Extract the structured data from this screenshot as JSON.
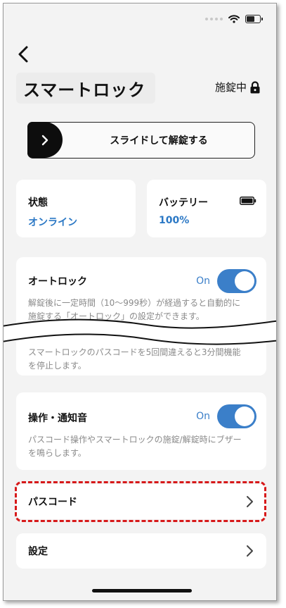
{
  "status_bar": {
    "wifi_icon": "wifi-icon",
    "battery_icon": "battery-icon"
  },
  "header": {
    "back_icon": "chevron-left-icon",
    "title": "スマートロック",
    "lock_status": "施錠中",
    "lock_icon": "lock-icon"
  },
  "slider": {
    "label": "スライドして解錠する",
    "knob_icon": "chevron-right-icon"
  },
  "status_card": {
    "title": "状態",
    "value": "オンライン"
  },
  "battery_card": {
    "title": "バッテリー",
    "value": "100%",
    "icon": "battery-icon"
  },
  "auto_lock": {
    "title": "オートロック",
    "toggle_label": "On",
    "enabled": true,
    "desc_line1": "解錠後に一定時間（10〜999秒）が経過すると自動的に",
    "desc_line2": "施錠する「オートロック」の設定ができます。",
    "desc_line3": "スマートロックのパスコードを5回間違えると3分間機能",
    "desc_line4": "を停止します。"
  },
  "sound": {
    "title": "操作・通知音",
    "toggle_label": "On",
    "enabled": true,
    "desc_line1": "パスコード操作やスマートロックの施錠/解錠時にブザー",
    "desc_line2": "を鳴らします。"
  },
  "menu": {
    "passcode_label": "パスコード",
    "settings_label": "設定"
  },
  "colors": {
    "accent": "#3b7fc9",
    "highlight": "#d7191a",
    "background": "#f3f3f3"
  }
}
